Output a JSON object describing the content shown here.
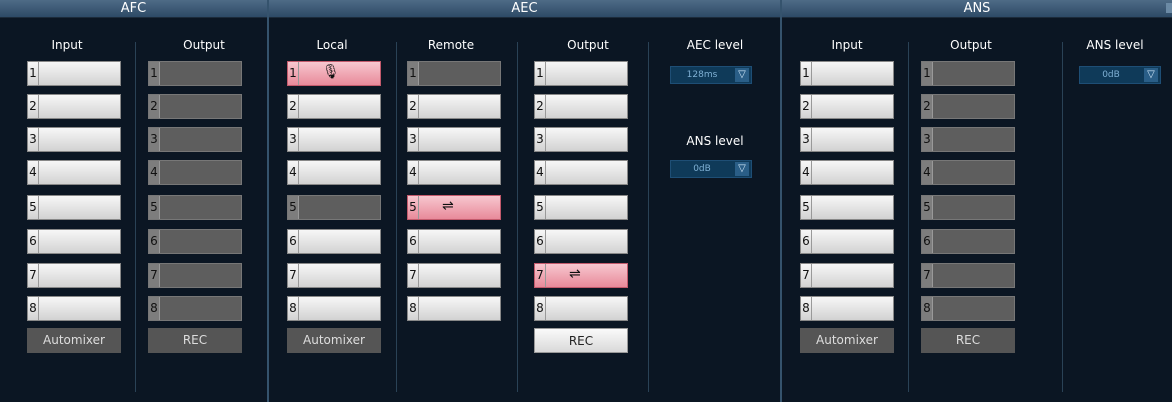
{
  "sections": {
    "afc": {
      "title": "AFC"
    },
    "aec": {
      "title": "AEC"
    },
    "ans": {
      "title": "ANS"
    }
  },
  "columns": {
    "afc_input": "Input",
    "afc_output": "Output",
    "aec_local": "Local",
    "aec_remote": "Remote",
    "aec_output": "Output",
    "aec_level": "AEC level",
    "ans_input": "Input",
    "ans_output": "Output",
    "ans_level": "ANS level"
  },
  "channels": [
    "1",
    "2",
    "3",
    "4",
    "5",
    "6",
    "7",
    "8"
  ],
  "buttons": {
    "afc_automixer": "Automixer",
    "afc_rec": "REC",
    "aec_automixer": "Automixer",
    "aec_rec": "REC",
    "ans_automixer": "Automixer",
    "ans_rec": "REC"
  },
  "aec_level": {
    "label": "AEC level",
    "value": "128ms"
  },
  "aec_ans_level": {
    "label": "ANS level",
    "value": "0dB"
  },
  "ans_level": {
    "label": "ANS level",
    "value": "0dB"
  },
  "icons": {
    "mic": "microphone-icon",
    "swap": "swap-arrows-icon"
  },
  "colors": {
    "pink_active": "#e88a9a",
    "header": "#3c5a76",
    "background": "#0b1623"
  }
}
